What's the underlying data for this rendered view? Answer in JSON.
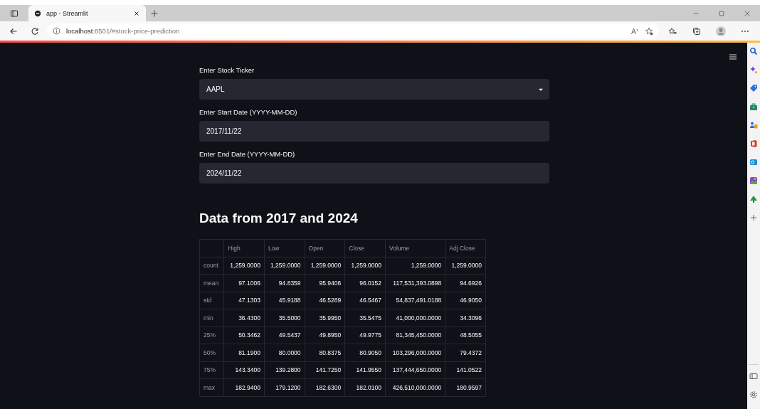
{
  "browser": {
    "tab_title": "app - Streamlit",
    "url_host": "localhost",
    "url_rest": ":8501/#stock-price-prediction"
  },
  "form": {
    "ticker": {
      "label": "Enter Stock Ticker",
      "value": "AAPL"
    },
    "fields": [
      {
        "label": "Enter Start Date (YYYY-MM-DD)",
        "value": "2017/11/22"
      },
      {
        "label": "Enter End Date (YYYY-MM-DD)",
        "value": "2024/11/22"
      }
    ]
  },
  "heading": "Data from 2017 and 2024",
  "table": {
    "columns": [
      "High",
      "Low",
      "Open",
      "Close",
      "Volume",
      "Adj Close"
    ],
    "rows": [
      {
        "index": "count",
        "cells": [
          "1,259.0000",
          "1,259.0000",
          "1,259.0000",
          "1,259.0000",
          "1,259.0000",
          "1,259.0000"
        ]
      },
      {
        "index": "mean",
        "cells": [
          "97.1006",
          "94.8359",
          "95.9406",
          "96.0152",
          "117,531,393.0898",
          "94.6926"
        ]
      },
      {
        "index": "std",
        "cells": [
          "47.1303",
          "45.9188",
          "46.5289",
          "46.5467",
          "54,837,491.0188",
          "46.9050"
        ]
      },
      {
        "index": "min",
        "cells": [
          "36.4300",
          "35.5000",
          "35.9950",
          "35.5475",
          "41,000,000.0000",
          "34.3096"
        ]
      },
      {
        "index": "25%",
        "cells": [
          "50.3462",
          "49.5437",
          "49.8950",
          "49.9775",
          "81,345,450.0000",
          "48.5055"
        ]
      },
      {
        "index": "50%",
        "cells": [
          "81.1900",
          "80.0000",
          "80.8375",
          "80.9050",
          "103,296,000.0000",
          "79.4372"
        ]
      },
      {
        "index": "75%",
        "cells": [
          "143.3400",
          "139.2800",
          "141.7250",
          "141.9550",
          "137,444,650.0000",
          "141.0522"
        ]
      },
      {
        "index": "max",
        "cells": [
          "182.9400",
          "179.1200",
          "182.6300",
          "182.0100",
          "426,510,000.0000",
          "180.9597"
        ]
      }
    ]
  }
}
